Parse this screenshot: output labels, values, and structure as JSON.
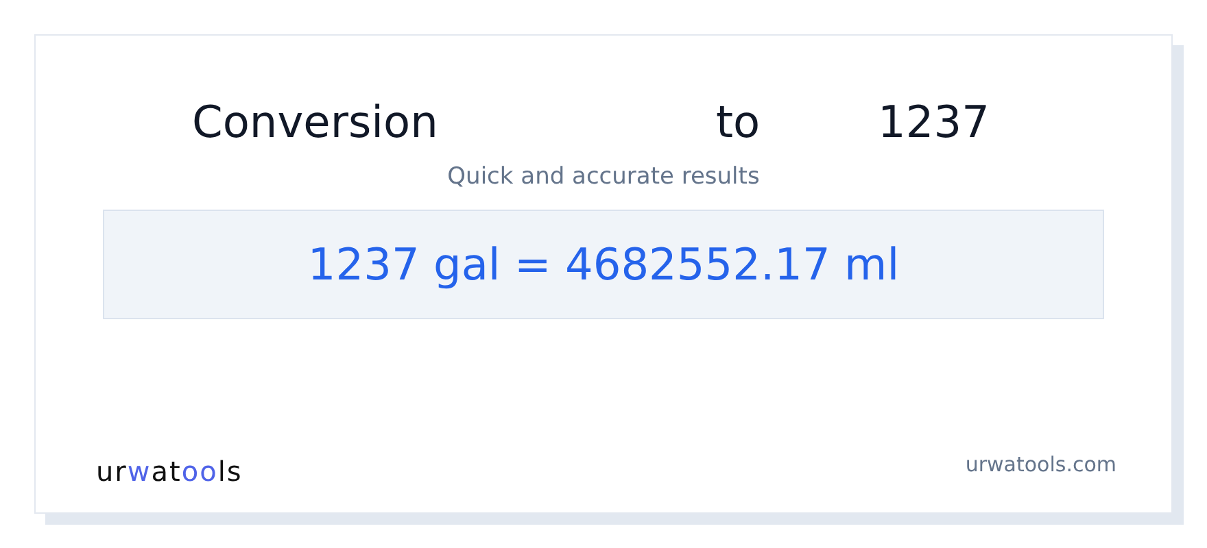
{
  "heading": [
    "Conversion",
    "to",
    "1237"
  ],
  "subtitle": "Quick and accurate results",
  "result": "1237 gal = 4682552.17 ml",
  "logo": [
    {
      "text": "ur",
      "accent": false
    },
    {
      "text": "w",
      "accent": true
    },
    {
      "text": "at",
      "accent": false
    },
    {
      "text": "oo",
      "accent": true
    },
    {
      "text": "ls",
      "accent": false
    }
  ],
  "site": "urwatools.com"
}
